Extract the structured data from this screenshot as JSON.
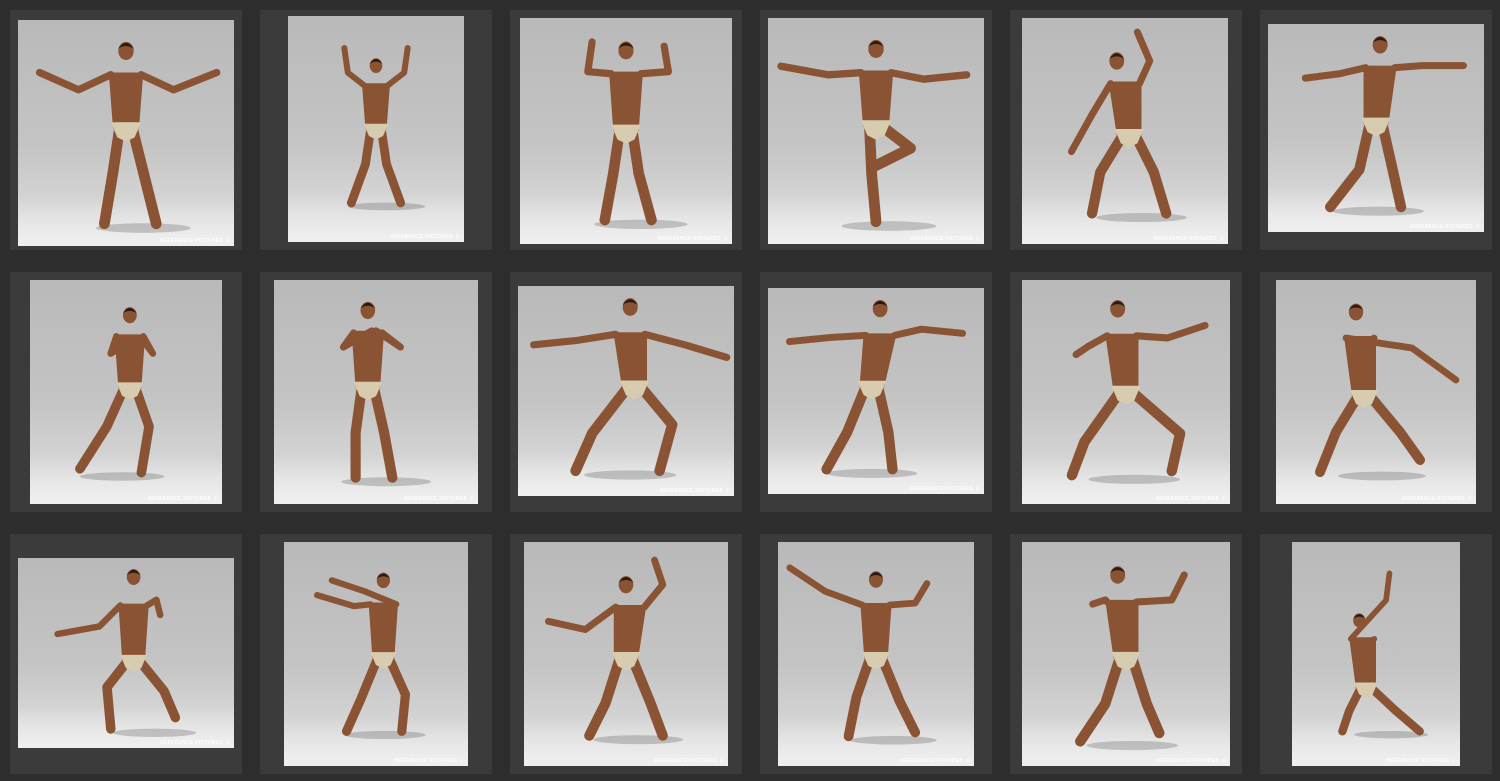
{
  "gallery": {
    "watermark_text": "REFERENCE PICTURES",
    "watermark_icon": "walking-figure-icon",
    "colors": {
      "page_background": "#2d2d2d",
      "cell_background": "#3b3b3b",
      "backdrop": "#c4c4c4",
      "skin": "#8a5434",
      "briefs": "#d8ccb0"
    },
    "thumbnails": [
      {
        "id": "pose-1",
        "pose": "arms-spread-wide"
      },
      {
        "id": "pose-2",
        "pose": "arms-raised-overhead"
      },
      {
        "id": "pose-3",
        "pose": "arms-flexed"
      },
      {
        "id": "pose-4",
        "pose": "one-leg-balance-arms-out"
      },
      {
        "id": "pose-5",
        "pose": "one-arm-up-lunge"
      },
      {
        "id": "pose-6",
        "pose": "arms-out-walking"
      },
      {
        "id": "pose-7",
        "pose": "hands-together-stance"
      },
      {
        "id": "pose-8",
        "pose": "hands-together-standing"
      },
      {
        "id": "pose-9",
        "pose": "deep-lunge-arms-out"
      },
      {
        "id": "pose-10",
        "pose": "back-view-arms-out"
      },
      {
        "id": "pose-11",
        "pose": "wide-lunge-arms-out"
      },
      {
        "id": "pose-12",
        "pose": "kneeling-lunge-reach"
      },
      {
        "id": "pose-13",
        "pose": "crouching-reach"
      },
      {
        "id": "pose-14",
        "pose": "step-arms-forward"
      },
      {
        "id": "pose-15",
        "pose": "step-one-arm-up"
      },
      {
        "id": "pose-16",
        "pose": "step-arms-raised"
      },
      {
        "id": "pose-17",
        "pose": "stride-arm-flexed"
      },
      {
        "id": "pose-18",
        "pose": "kneeling-arm-up"
      }
    ]
  }
}
